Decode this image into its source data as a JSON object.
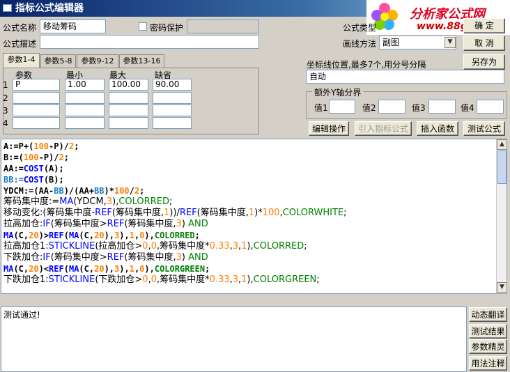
{
  "window": {
    "title": "指标公式编辑器"
  },
  "logo": {
    "line1": "分析家公式网",
    "line2": "www.88gs.com"
  },
  "form": {
    "name_label": "公式名称",
    "name_value": "移动筹码",
    "password_label": "密码保护",
    "password_value": "",
    "desc_label": "公式描述",
    "desc_value": "",
    "type_label": "公式类型",
    "type_value": "指标类型",
    "draw_label": "画线方法",
    "draw_value": "副图"
  },
  "buttons": {
    "ok": "确 定",
    "cancel": "取 消",
    "save_as": "另存为",
    "edit": "编辑操作",
    "import": "引入指标公式",
    "insert": "插入函数",
    "test": "测试公式"
  },
  "tabs": [
    "参数1-4",
    "参数5-8",
    "参数9-12",
    "参数13-16"
  ],
  "params": {
    "headers": [
      "参数",
      "最小",
      "最大",
      "缺省"
    ],
    "rows": [
      {
        "idx": "1",
        "name": "P",
        "min": "1.00",
        "max": "100.00",
        "def": "90.00"
      },
      {
        "idx": "2",
        "name": "",
        "min": "",
        "max": "",
        "def": ""
      },
      {
        "idx": "3",
        "name": "",
        "min": "",
        "max": "",
        "def": ""
      },
      {
        "idx": "4",
        "name": "",
        "min": "",
        "max": "",
        "def": ""
      }
    ]
  },
  "axis": {
    "label": "坐标线位置,最多7个,用分号分隔",
    "value": "自动",
    "group_title": "额外Y轴分界",
    "v_labels": [
      "值1",
      "值2",
      "值3",
      "值4"
    ],
    "v_values": [
      "",
      "",
      "",
      ""
    ]
  },
  "code": [
    [
      [
        "A:=P+(",
        "k-blk"
      ],
      [
        "100",
        "k-num"
      ],
      [
        "-P)/",
        "k-blk"
      ],
      [
        "2",
        "k-num"
      ],
      [
        ";",
        "k-blk"
      ]
    ],
    [
      [
        "B:=(",
        "k-blk"
      ],
      [
        "100",
        "k-num"
      ],
      [
        "-P)/",
        "k-blk"
      ],
      [
        "2",
        "k-num"
      ],
      [
        ";",
        "k-blk"
      ]
    ],
    [
      [
        "AA:=",
        "k-blk"
      ],
      [
        "COST",
        "k-fn"
      ],
      [
        "(A);",
        "k-blk"
      ]
    ],
    [
      [
        "BB:=",
        "k-var"
      ],
      [
        "COST",
        "k-fn"
      ],
      [
        "(B);",
        "k-blk"
      ]
    ],
    [
      [
        "YDCM:=(AA-",
        "k-blk"
      ],
      [
        "BB",
        "k-var"
      ],
      [
        ")/(AA+",
        "k-blk"
      ],
      [
        "BB",
        "k-var"
      ],
      [
        ")*",
        "k-blk"
      ],
      [
        "100",
        "k-num"
      ],
      [
        "/",
        "k-blk"
      ],
      [
        "2",
        "k-num"
      ],
      [
        ";",
        "k-blk"
      ]
    ],
    [
      [
        "筹码集中度:=",
        "k-blk"
      ],
      [
        "MA",
        "k-fn"
      ],
      [
        "(YDCM,",
        "k-blk"
      ],
      [
        "3",
        "k-num"
      ],
      [
        "),",
        "k-blk"
      ],
      [
        "COLORRED",
        "k-col"
      ],
      [
        ";",
        "k-blk"
      ]
    ],
    [
      [
        "移动变化:(筹码集中度-",
        "k-blk"
      ],
      [
        "REF",
        "k-fn"
      ],
      [
        "(筹码集中度,",
        "k-blk"
      ],
      [
        "1",
        "k-num"
      ],
      [
        "))/",
        "k-blk"
      ],
      [
        "REF",
        "k-fn"
      ],
      [
        "(筹码集中度,",
        "k-blk"
      ],
      [
        "1",
        "k-num"
      ],
      [
        ")*",
        "k-blk"
      ],
      [
        "100",
        "k-num"
      ],
      [
        ",",
        "k-blk"
      ],
      [
        "COLORWHITE",
        "k-col"
      ],
      [
        ";",
        "k-blk"
      ]
    ],
    [
      [
        "拉高加仓:",
        "k-blk"
      ],
      [
        "IF",
        "k-fn"
      ],
      [
        "(筹码集中度>",
        "k-blk"
      ],
      [
        "REF",
        "k-fn"
      ],
      [
        "(筹码集中度,",
        "k-blk"
      ],
      [
        "3",
        "k-num"
      ],
      [
        ") ",
        "k-blk"
      ],
      [
        "AND",
        "k-kw"
      ]
    ],
    [
      [
        "MA",
        "k-fn"
      ],
      [
        "(C,",
        "k-blk"
      ],
      [
        "20",
        "k-num"
      ],
      [
        ")>",
        "k-blk"
      ],
      [
        "REF",
        "k-fn"
      ],
      [
        "(",
        "k-blk"
      ],
      [
        "MA",
        "k-fn"
      ],
      [
        "(C,",
        "k-blk"
      ],
      [
        "20",
        "k-num"
      ],
      [
        "),",
        "k-blk"
      ],
      [
        "3",
        "k-num"
      ],
      [
        "),",
        "k-blk"
      ],
      [
        "1",
        "k-num"
      ],
      [
        ",",
        "k-blk"
      ],
      [
        "0",
        "k-num"
      ],
      [
        "),",
        "k-blk"
      ],
      [
        "COLORRED",
        "k-col"
      ],
      [
        ";",
        "k-blk"
      ]
    ],
    [
      [
        "拉高加仓1:",
        "k-blk"
      ],
      [
        "STICKLINE",
        "k-fn"
      ],
      [
        "(拉高加仓>",
        "k-blk"
      ],
      [
        "0",
        "k-num"
      ],
      [
        ",",
        "k-blk"
      ],
      [
        "0",
        "k-num"
      ],
      [
        ",筹码集中度*",
        "k-blk"
      ],
      [
        "0.33",
        "k-num"
      ],
      [
        ",",
        "k-blk"
      ],
      [
        "3",
        "k-num"
      ],
      [
        ",",
        "k-blk"
      ],
      [
        "1",
        "k-num"
      ],
      [
        "),",
        "k-blk"
      ],
      [
        "COLORRED",
        "k-col"
      ],
      [
        ";",
        "k-blk"
      ]
    ],
    [
      [
        "下跌加仓:",
        "k-blk"
      ],
      [
        "IF",
        "k-fn"
      ],
      [
        "(筹码集中度>",
        "k-blk"
      ],
      [
        "REF",
        "k-fn"
      ],
      [
        "(筹码集中度,",
        "k-blk"
      ],
      [
        "3",
        "k-num"
      ],
      [
        ") ",
        "k-blk"
      ],
      [
        "AND",
        "k-kw"
      ]
    ],
    [
      [
        "MA",
        "k-fn"
      ],
      [
        "(C,",
        "k-blk"
      ],
      [
        "20",
        "k-num"
      ],
      [
        ")<",
        "k-blk"
      ],
      [
        "REF",
        "k-fn"
      ],
      [
        "(",
        "k-blk"
      ],
      [
        "MA",
        "k-fn"
      ],
      [
        "(C,",
        "k-blk"
      ],
      [
        "20",
        "k-num"
      ],
      [
        "),",
        "k-blk"
      ],
      [
        "3",
        "k-num"
      ],
      [
        "),",
        "k-blk"
      ],
      [
        "1",
        "k-num"
      ],
      [
        ",",
        "k-blk"
      ],
      [
        "0",
        "k-num"
      ],
      [
        "),",
        "k-blk"
      ],
      [
        "COLORGREEN",
        "k-col"
      ],
      [
        ";",
        "k-blk"
      ]
    ],
    [
      [
        "下跌加仓1:",
        "k-blk"
      ],
      [
        "STICKLINE",
        "k-fn"
      ],
      [
        "(下跌加仓>",
        "k-blk"
      ],
      [
        "0",
        "k-num"
      ],
      [
        ",",
        "k-blk"
      ],
      [
        "0",
        "k-num"
      ],
      [
        ",筹码集中度*",
        "k-blk"
      ],
      [
        "0.33",
        "k-num"
      ],
      [
        ",",
        "k-blk"
      ],
      [
        "3",
        "k-num"
      ],
      [
        ",",
        "k-blk"
      ],
      [
        "1",
        "k-num"
      ],
      [
        "),",
        "k-blk"
      ],
      [
        "COLORGREEN",
        "k-col"
      ],
      [
        ";",
        "k-blk"
      ]
    ]
  ],
  "output": {
    "text": "测试通过!"
  },
  "side_buttons": [
    "动态翻译",
    "测试结果",
    "参数精灵",
    "用法注释"
  ]
}
